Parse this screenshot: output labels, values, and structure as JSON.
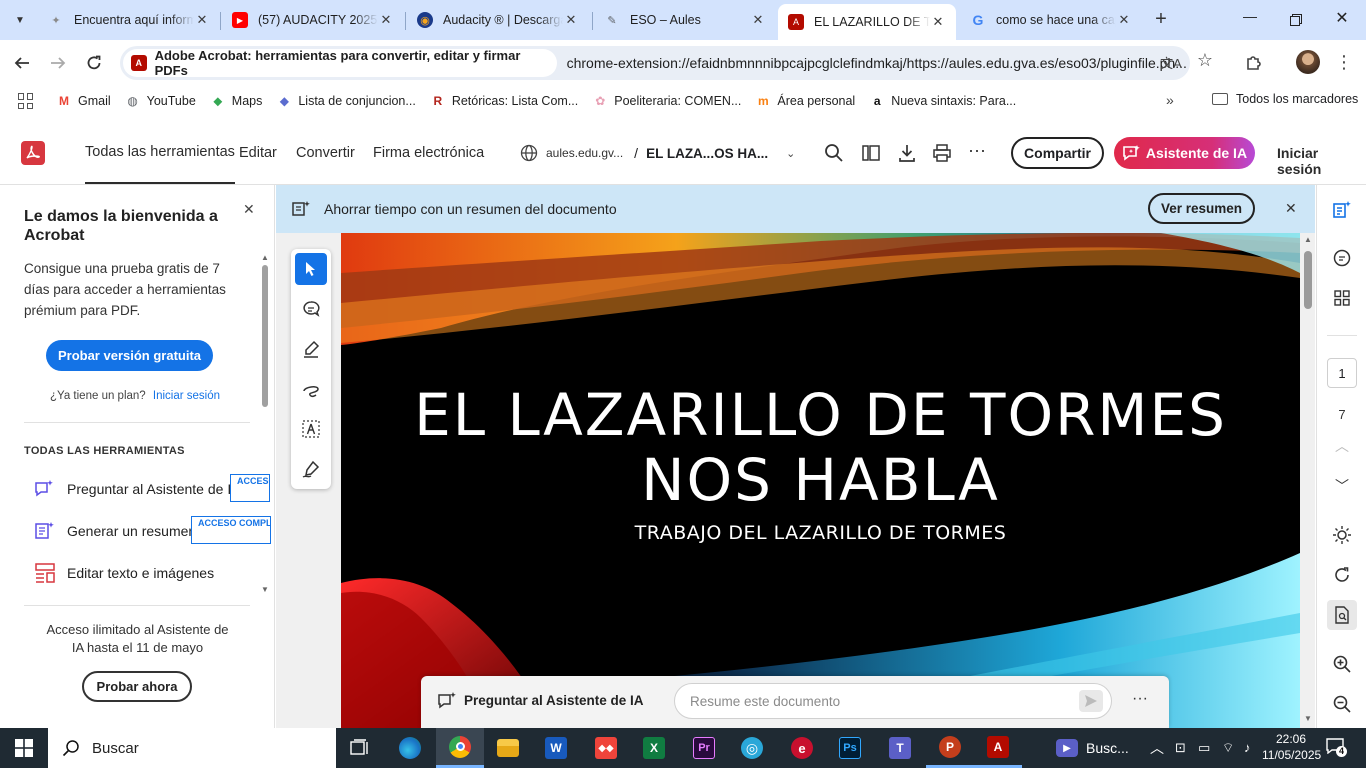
{
  "browser": {
    "tabs": [
      {
        "title": "Encuentra aquí información",
        "icon": "puzzle-favicon",
        "color": "#8a8a8a"
      },
      {
        "title": "(57) AUDACITY 2025 ©",
        "icon": "youtube-favicon",
        "color": "#ff0000"
      },
      {
        "title": "Audacity ® | Descarga",
        "icon": "audacity-favicon",
        "color": "#f7a51b"
      },
      {
        "title": "ESO – Aules",
        "icon": "aules-favicon",
        "color": "#5f6368"
      },
      {
        "title": "EL LAZARILLO DE TORMES",
        "icon": "acrobat-favicon",
        "color": "#b30b00",
        "active": true
      },
      {
        "title": "como se hace una captura",
        "icon": "google-favicon",
        "color": "#4285f4"
      }
    ],
    "omnibox": {
      "chip": "Adobe Acrobat: herramientas para convertir, editar y firmar PDFs",
      "url": "chrome-extension://efaidnbmnnnibpcajpcglclefindmkaj/https://aules.edu.gva.es/eso03/pluginfile.ph..."
    },
    "bookmarks": [
      {
        "label": "Gmail",
        "icon": "gmail-icon",
        "color": "#ea4335",
        "glyph": "M"
      },
      {
        "label": "YouTube",
        "icon": "globe-icon",
        "color": "#5f6368",
        "glyph": "◍"
      },
      {
        "label": "Maps",
        "icon": "maps-icon",
        "color": "#34a853",
        "glyph": "⬥"
      },
      {
        "label": "Lista de conjuncion...",
        "icon": "cube-icon",
        "color": "#5b6ccf",
        "glyph": "◆"
      },
      {
        "label": "Retóricas: Lista Com...",
        "icon": "r-icon",
        "color": "#b3261e",
        "glyph": "R"
      },
      {
        "label": "Poeliteraria: COMEN...",
        "icon": "flower-icon",
        "color": "#e8a0b4",
        "glyph": "✿"
      },
      {
        "label": "Área personal",
        "icon": "moodle-icon",
        "color": "#f98012",
        "glyph": "m"
      },
      {
        "label": "Nueva sintaxis: Para...",
        "icon": "amazon-icon",
        "color": "#111111",
        "glyph": "a"
      }
    ],
    "all_bookmarks": "Todos los marcadores"
  },
  "acrobat": {
    "menu": [
      "Todas las herramientas",
      "Editar",
      "Convertir",
      "Firma electrónica"
    ],
    "doc_domain": "aules.edu.gv...",
    "doc_sep": "/",
    "doc_title": "EL LAZA...OS HA...",
    "share": "Compartir",
    "ai_assistant": "Asistente de IA",
    "sign_in": "Iniciar sesión",
    "brand_color": "#d7373f",
    "ai_color": "#e0294a"
  },
  "left_panel": {
    "welcome": "Le damos la bienvenida a Acrobat",
    "trial_text": "Consigue una prueba gratis de 7 días para acceder a herramientas prémium para PDF.",
    "trial_button": "Probar versión gratuita",
    "plan_q": "¿Ya tiene un plan?",
    "plan_link": "Iniciar sesión",
    "section_title": "TODAS LAS HERRAMIENTAS",
    "tools": [
      {
        "label": "Preguntar al Asistente de IA",
        "badge": "ACCESO COMPLETO"
      },
      {
        "label": "Generar un resumen",
        "badge": "ACCESO COMPLETO"
      },
      {
        "label": "Editar texto e imágenes",
        "badge": ""
      }
    ],
    "promo": "Acceso ilimitado al Asistente de IA hasta el 11 de mayo",
    "promo_button": "Probar ahora"
  },
  "viewer": {
    "banner_text": "Ahorrar tiempo con un resumen del documento",
    "banner_button": "Ver resumen",
    "slide_title_1": "EL LAZARILLO DE TORMES",
    "slide_title_2": "NOS HABLA",
    "slide_subtitle": "TRABAJO DEL LAZARILLO DE TORMES",
    "chat_label": "Preguntar al Asistente de IA",
    "chat_placeholder": "Resume este documento"
  },
  "right_rail": {
    "page_current": "1",
    "page_total": "7"
  },
  "taskbar": {
    "search": "Buscar",
    "search_app": "Busc...",
    "time": "22:06",
    "date": "11/05/2025",
    "notifications": "4"
  }
}
